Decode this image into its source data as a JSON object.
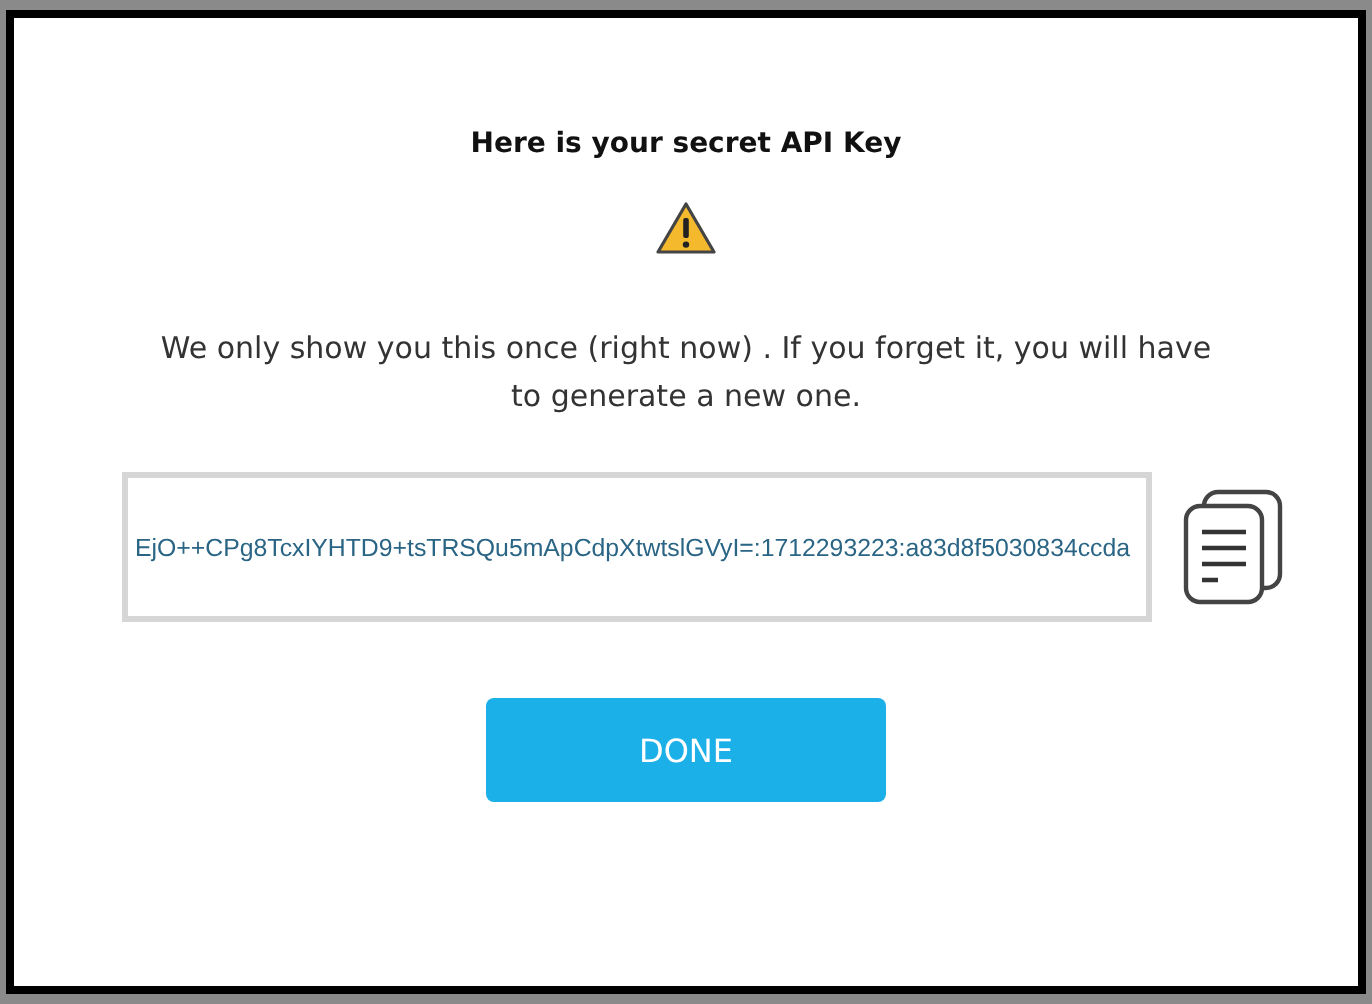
{
  "dialog": {
    "title": "Here is your secret API Key",
    "message": "We only show you this once (right now) . If you forget it, you will have to generate a new one.",
    "api_key": "EjO++CPg8TcxIYHTD9+tsTRSQu5mApCdpXtwtslGVyI=:1712293223:a83d8f5030834ccda",
    "button": "DONE"
  }
}
